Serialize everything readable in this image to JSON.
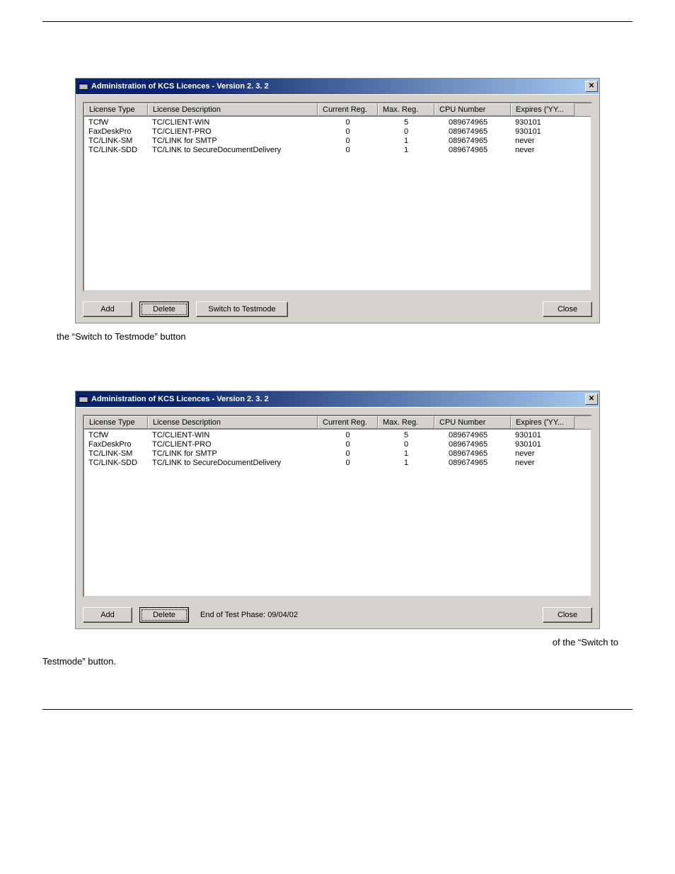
{
  "window_title": "Administration of KCS Licences - Version  2. 3. 2",
  "columns": {
    "type": "License Type",
    "desc": "License Description",
    "cur": "Current Reg.",
    "max": "Max. Reg.",
    "cpu": "CPU Number",
    "exp": "Expires ('YY..."
  },
  "rows": [
    {
      "type": "TCfW",
      "desc": "TC/CLIENT-WIN",
      "cur": "0",
      "max": "5",
      "cpu": "089674965",
      "exp": "930101"
    },
    {
      "type": "FaxDeskPro",
      "desc": "TC/CLIENT-PRO",
      "cur": "0",
      "max": "0",
      "cpu": "089674965",
      "exp": "930101"
    },
    {
      "type": "TC/LINK-SM",
      "desc": "TC/LINK for SMTP",
      "cur": "0",
      "max": "1",
      "cpu": "089674965",
      "exp": "never"
    },
    {
      "type": "TC/LINK-SDD",
      "desc": "TC/LINK to SecureDocumentDelivery",
      "cur": "0",
      "max": "1",
      "cpu": "089674965",
      "exp": "never"
    }
  ],
  "buttons": {
    "add": "Add",
    "delete": "Delete",
    "switch": "Switch to Testmode",
    "close": "Close"
  },
  "test_phase_label": "End of Test Phase:  09/04/02",
  "doc": {
    "caption1": "the “Switch to Testmode” button",
    "caption2a": "of the “Switch to",
    "caption2b": "Testmode” button."
  }
}
